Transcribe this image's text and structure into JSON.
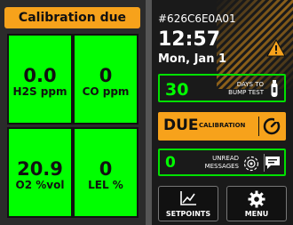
{
  "status_banner": "Calibration due",
  "gases": [
    {
      "value": "0.0",
      "label": "H2S ppm"
    },
    {
      "value": "0",
      "label": "CO ppm"
    },
    {
      "value": "20.9",
      "label": "O2 %vol"
    },
    {
      "value": "0",
      "label": "LEL %"
    }
  ],
  "device": {
    "id": "#626C6E0A01",
    "time": "12:57",
    "date": "Mon, Jan 1"
  },
  "bump_test": {
    "days": "30",
    "label_line1": "DAYS TO",
    "label_line2": "BUMP TEST"
  },
  "calibration": {
    "status": "DUE",
    "label": "CALIBRATION"
  },
  "messages": {
    "count": "0",
    "label_line1": "UNREAD",
    "label_line2": "MESSAGES"
  },
  "buttons": {
    "setpoints": "SETPOINTS",
    "menu": "MENU"
  },
  "colors": {
    "alarm_green": "#00ff00",
    "warning_orange": "#f7a21b",
    "background": "#1a1a1a"
  },
  "icons": {
    "warning": "warning-triangle-icon",
    "bump": "gas-cylinder-icon",
    "calibration": "gauge-icon",
    "messages_target": "target-icon",
    "messages_chat": "chat-icon",
    "setpoints": "line-graph-icon",
    "menu": "gear-icon"
  }
}
